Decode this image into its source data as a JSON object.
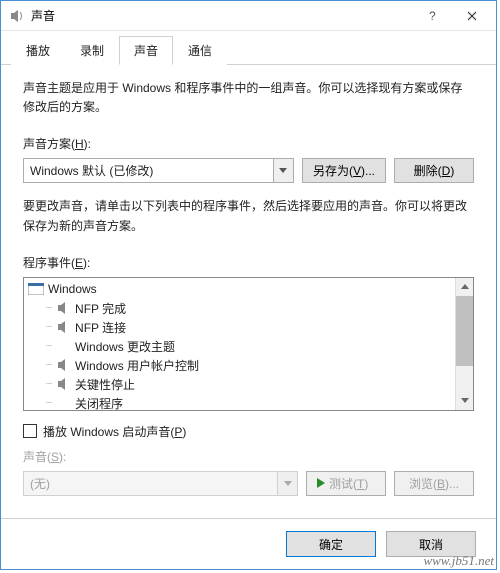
{
  "window": {
    "title": "声音"
  },
  "tabs": {
    "playback": "播放",
    "record": "录制",
    "sounds": "声音",
    "comm": "通信"
  },
  "page": {
    "description": "声音主题是应用于 Windows 和程序事件中的一组声音。你可以选择现有方案或保存修改后的方案。",
    "scheme_label": "声音方案(",
    "scheme_mnemonic": "H",
    "scheme_label_end": "):",
    "scheme_value": "Windows 默认 (已修改)",
    "save_as": "另存为(",
    "save_as_mnemonic": "V",
    "save_as_end": ")...",
    "delete": "删除(",
    "delete_mnemonic": "D",
    "delete_end": ")",
    "hint": "要更改声音，请单击以下列表中的程序事件，然后选择要应用的声音。你可以将更改保存为新的声音方案。",
    "events_label": "程序事件(",
    "events_mnemonic": "E",
    "events_label_end": "):",
    "tree": {
      "root": "Windows",
      "items": [
        {
          "label": "NFP 完成",
          "hasSpeaker": true
        },
        {
          "label": "NFP 连接",
          "hasSpeaker": true
        },
        {
          "label": "Windows 更改主题",
          "hasSpeaker": false
        },
        {
          "label": "Windows 用户帐户控制",
          "hasSpeaker": true
        },
        {
          "label": "关键性停止",
          "hasSpeaker": true
        },
        {
          "label": "关闭程序",
          "hasSpeaker": false
        }
      ]
    },
    "play_startup": "播放 Windows 启动声音(",
    "play_startup_mnemonic": "P",
    "play_startup_end": ")",
    "sound_label": "声音(",
    "sound_mnemonic": "S",
    "sound_label_end": "):",
    "sound_value": "(无)",
    "test": "测试(",
    "test_mnemonic": "T",
    "test_end": ")",
    "browse": "浏览(",
    "browse_mnemonic": "B",
    "browse_end": ")..."
  },
  "footer": {
    "ok": "确定",
    "cancel": "取消"
  },
  "watermark": "www.jb51.net"
}
